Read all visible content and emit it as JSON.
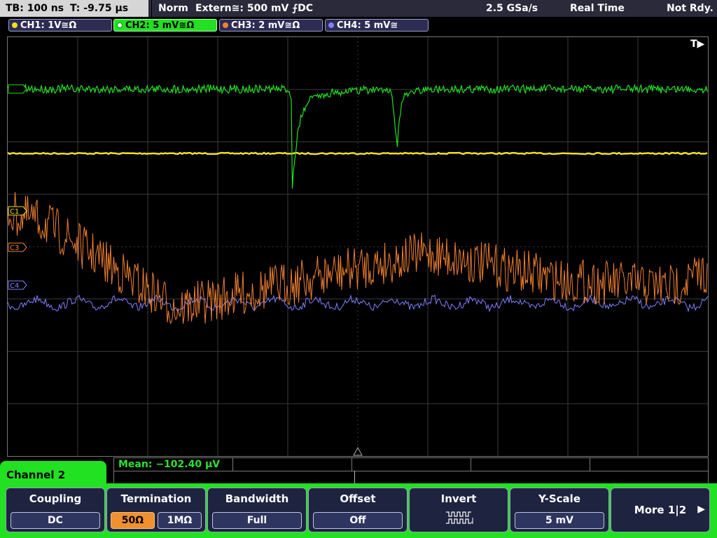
{
  "topbar": {
    "timebase": "TB: 100 ns",
    "trigger_time": "T: -9.75 µs",
    "mode": "Norm",
    "trigger_source": "Extern≅: 500 mV ⨍DC",
    "sample_rate": "2.5 GSa/s",
    "acq_mode": "Real Time",
    "status": "Not Rdy."
  },
  "channels": [
    {
      "label": "CH1: 1V≅Ω",
      "color": "#f0e020"
    },
    {
      "label": "CH2: 5 mV≅Ω",
      "color": "#22e022",
      "active": true
    },
    {
      "label": "CH3: 2 mV≅Ω",
      "color": "#f08030"
    },
    {
      "label": "CH4: 5 mV≅",
      "color": "#8080ff"
    }
  ],
  "scope": {
    "trigger_marker": "T▶",
    "markers": [
      "C1",
      "C3",
      "C4"
    ]
  },
  "measure": {
    "mean": "Mean: −102.40 µV"
  },
  "panel": {
    "channel_name": "Channel 2"
  },
  "softkeys": {
    "coupling": {
      "title": "Coupling",
      "value": "DC"
    },
    "termination": {
      "title": "Termination",
      "options": [
        "50Ω",
        "1MΩ"
      ],
      "selected": "50Ω"
    },
    "bandwidth": {
      "title": "Bandwidth",
      "value": "Full"
    },
    "offset": {
      "title": "Offset",
      "value": "Off"
    },
    "invert": {
      "title": "Invert",
      "icon": "invert-waveform-icon"
    },
    "yscale": {
      "title": "Y-Scale",
      "value": "5 mV"
    },
    "more": {
      "label": "More 1|2",
      "icon": "arrow-right-icon"
    }
  }
}
